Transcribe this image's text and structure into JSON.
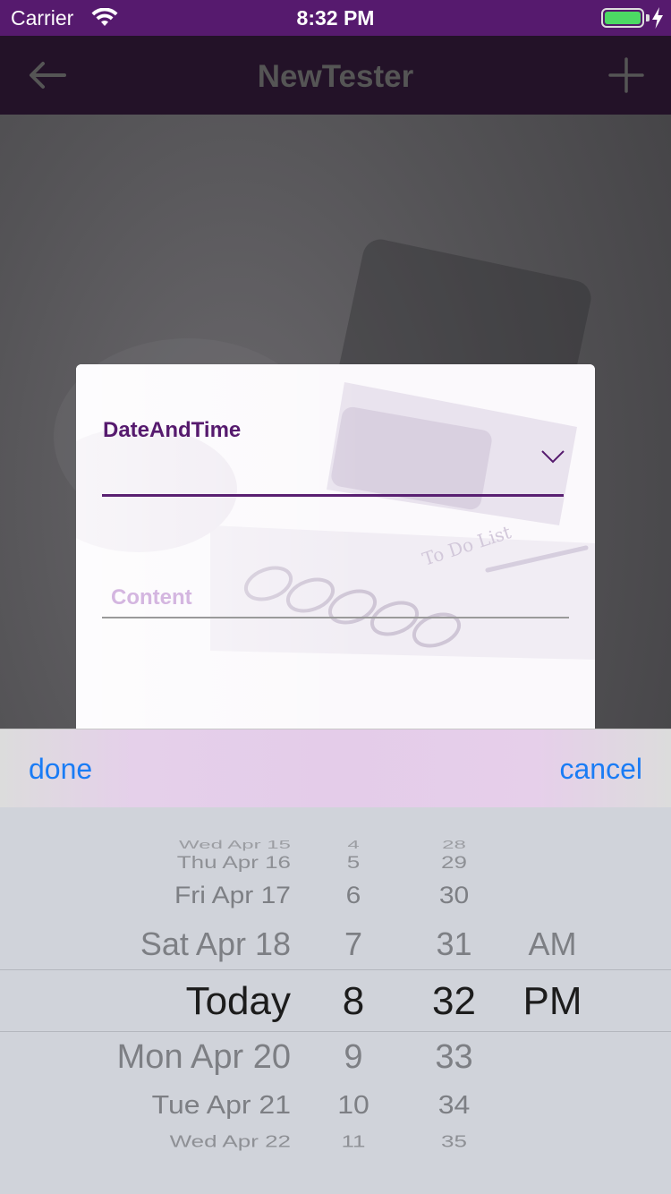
{
  "status_bar": {
    "carrier": "Carrier",
    "time": "8:32 PM",
    "wifi_icon": "wifi-icon",
    "battery_icon": "battery-icon",
    "charging_icon": "bolt-icon",
    "bar_color": "#561a6e",
    "battery_color": "#4cd964"
  },
  "nav_bar": {
    "title": "NewTester",
    "back_icon": "arrow-left-icon",
    "add_icon": "plus-icon"
  },
  "dialog": {
    "date_label": "DateAndTime",
    "dropdown_icon": "chevron-down-icon",
    "content_placeholder": "Content",
    "content_value": "",
    "accent_color": "#561a6e"
  },
  "picker_toolbar": {
    "done_label": "done",
    "cancel_label": "cancel",
    "button_color": "#1a7cf5"
  },
  "picker": {
    "dates": [
      "Wed Apr 15",
      "Thu Apr 16",
      "Fri Apr 17",
      "Sat Apr 18",
      "Today",
      "Mon Apr 20",
      "Tue Apr 21",
      "Wed Apr 22"
    ],
    "hours": [
      "4",
      "5",
      "6",
      "7",
      "8",
      "9",
      "10",
      "11"
    ],
    "minutes": [
      "28",
      "29",
      "30",
      "31",
      "32",
      "33",
      "34",
      "35"
    ],
    "ampm": [
      "AM",
      "PM"
    ],
    "selected": {
      "date": "Today",
      "hour": "8",
      "minute": "32",
      "ampm": "PM"
    }
  }
}
